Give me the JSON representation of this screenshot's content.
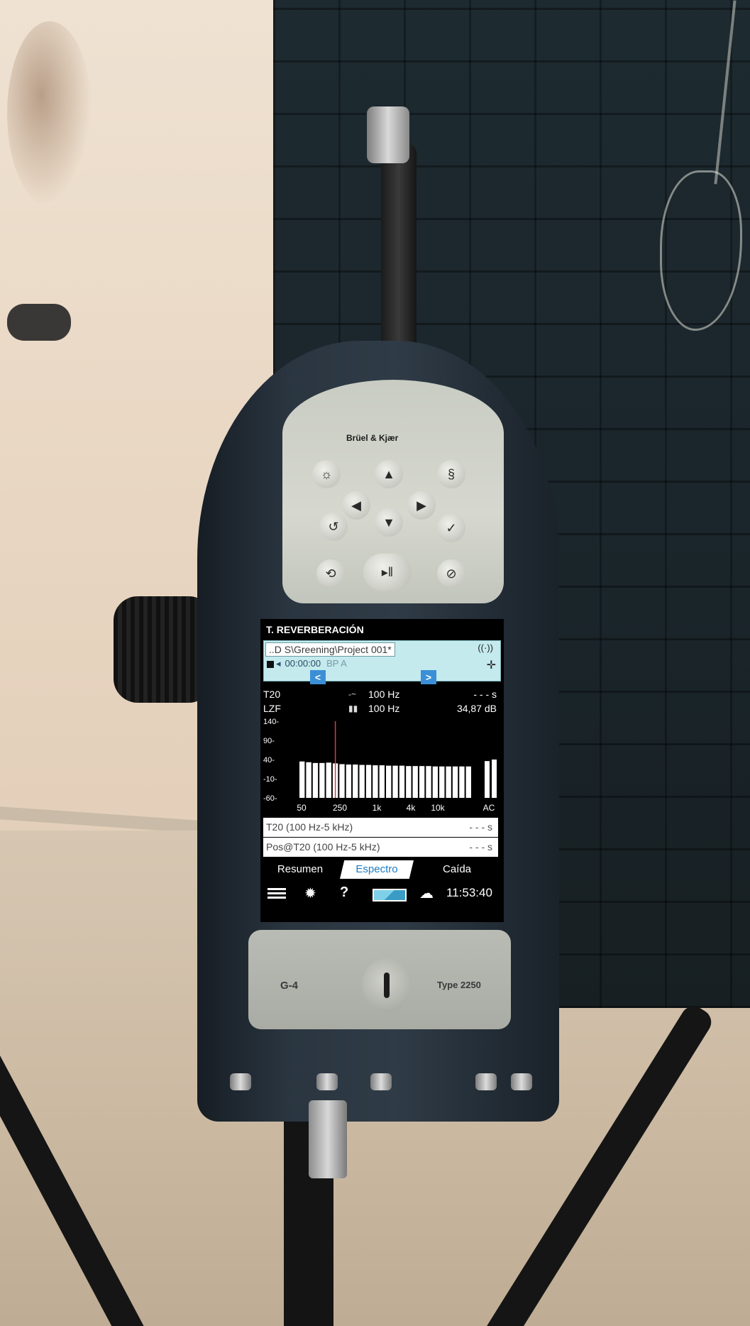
{
  "device": {
    "brand": "Brüel & Kjær",
    "model_left": "G-4",
    "model_right": "Type 2250"
  },
  "screen": {
    "title": "T. REVERBERACIÓN",
    "project_path": "..D S\\Greening\\Project 001*",
    "elapsed_time": "00:00:00",
    "bp_label": "BP A",
    "nav_prev": "<",
    "nav_next": ">",
    "measurements": [
      {
        "param": "T20",
        "icon": "-~",
        "freq": "100 Hz",
        "value": "- - - s"
      },
      {
        "param": "LZF",
        "icon": "▮▮",
        "freq": "100 Hz",
        "value": "34,87 dB"
      }
    ],
    "results": [
      {
        "label": "T20 (100 Hz-5 kHz)",
        "value": "- - - s"
      },
      {
        "label": "Pos@T20 (100 Hz-5 kHz)",
        "value": "- - - s"
      }
    ],
    "tabs": [
      "Resumen",
      "Espectro",
      "Caída"
    ],
    "active_tab": 1,
    "clock": "11:53:40"
  },
  "chart_data": {
    "type": "bar",
    "y_ticks": [
      "140-",
      "90-",
      "40-",
      "-10-",
      "-60-"
    ],
    "ylim": [
      -60,
      140
    ],
    "x_ticks": [
      "50",
      "250",
      "1k",
      "4k",
      "10k",
      "AC"
    ],
    "cursor_band_index": 5,
    "values": [
      35,
      33,
      31,
      31,
      32,
      30,
      28,
      27,
      27,
      26,
      26,
      25,
      25,
      24,
      24,
      24,
      23,
      23,
      23,
      23,
      22,
      22,
      22,
      22,
      22,
      22
    ],
    "extra_bars": [
      {
        "label": "A",
        "value": 36
      },
      {
        "label": "C",
        "value": 40
      }
    ],
    "colors": {
      "bar": "#ffffff",
      "cursor": "#e53935",
      "axis": "#ffffff"
    }
  }
}
